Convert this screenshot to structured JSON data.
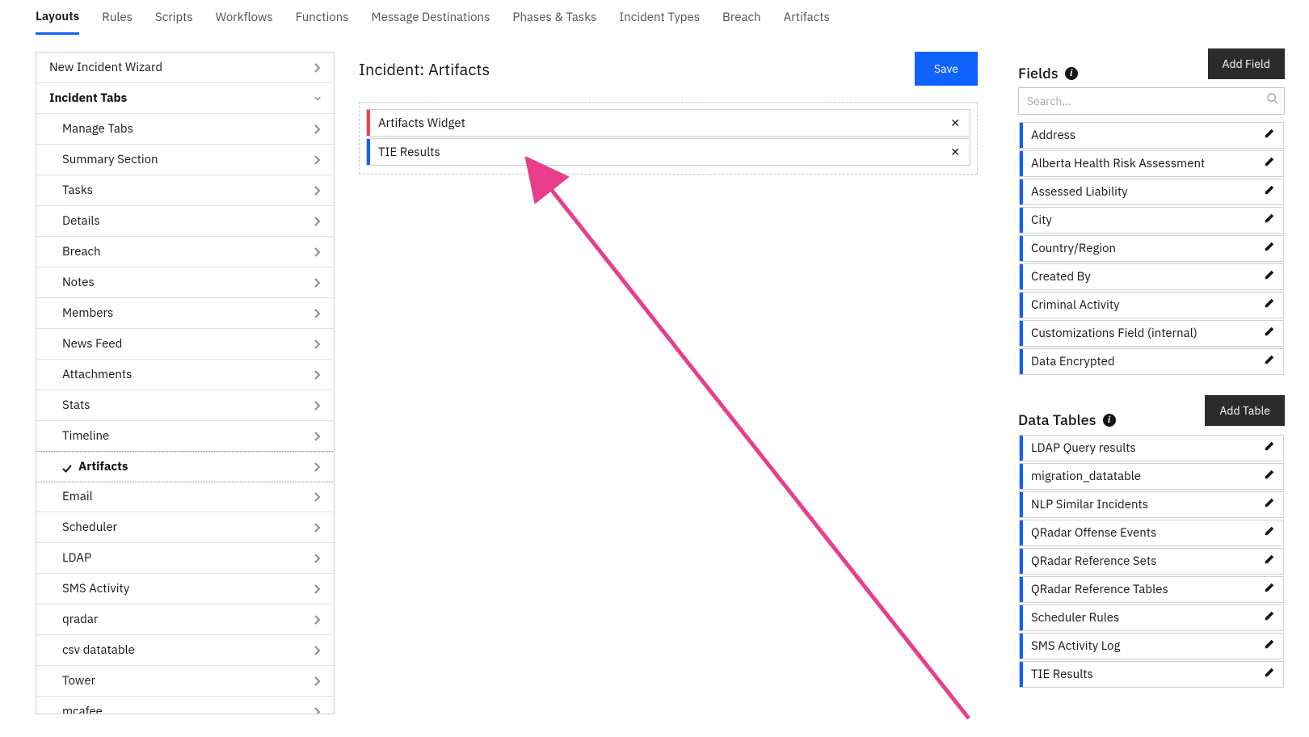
{
  "top_tabs": [
    {
      "label": "Layouts",
      "active": true
    },
    {
      "label": "Rules",
      "active": false
    },
    {
      "label": "Scripts",
      "active": false
    },
    {
      "label": "Workflows",
      "active": false
    },
    {
      "label": "Functions",
      "active": false
    },
    {
      "label": "Message Destinations",
      "active": false
    },
    {
      "label": "Phases & Tasks",
      "active": false
    },
    {
      "label": "Incident Types",
      "active": false
    },
    {
      "label": "Breach",
      "active": false
    },
    {
      "label": "Artifacts",
      "active": false
    }
  ],
  "sidebar": {
    "wizard_label": "New Incident Wizard",
    "section_label": "Incident Tabs",
    "items": [
      {
        "label": "Manage Tabs",
        "active": false
      },
      {
        "label": "Summary Section",
        "active": false
      },
      {
        "label": "Tasks",
        "active": false
      },
      {
        "label": "Details",
        "active": false
      },
      {
        "label": "Breach",
        "active": false
      },
      {
        "label": "Notes",
        "active": false
      },
      {
        "label": "Members",
        "active": false
      },
      {
        "label": "News Feed",
        "active": false
      },
      {
        "label": "Attachments",
        "active": false
      },
      {
        "label": "Stats",
        "active": false
      },
      {
        "label": "Timeline",
        "active": false
      },
      {
        "label": "Artifacts",
        "active": true
      },
      {
        "label": "Email",
        "active": false
      },
      {
        "label": "Scheduler",
        "active": false
      },
      {
        "label": "LDAP",
        "active": false
      },
      {
        "label": "SMS Activity",
        "active": false
      },
      {
        "label": "qradar",
        "active": false
      },
      {
        "label": "csv datatable",
        "active": false
      },
      {
        "label": "Tower",
        "active": false
      },
      {
        "label": "mcafee",
        "active": false
      }
    ]
  },
  "editor": {
    "heading": "Incident: Artifacts",
    "save_label": "Save",
    "widgets": [
      {
        "label": "Artifacts Widget",
        "color": "red"
      },
      {
        "label": "TIE Results",
        "color": "blue"
      }
    ]
  },
  "right": {
    "fields_label": "Fields",
    "add_field_label": "Add Field",
    "search_placeholder": "Search…",
    "fields": [
      {
        "label": "Address"
      },
      {
        "label": "Alberta Health Risk Assessment"
      },
      {
        "label": "Assessed Liability"
      },
      {
        "label": "City"
      },
      {
        "label": "Country/Region"
      },
      {
        "label": "Created By"
      },
      {
        "label": "Criminal Activity"
      },
      {
        "label": "Customizations Field (internal)"
      },
      {
        "label": "Data Encrypted"
      }
    ],
    "tables_label": "Data Tables",
    "add_table_label": "Add Table",
    "tables": [
      {
        "label": "LDAP Query results"
      },
      {
        "label": "migration_datatable"
      },
      {
        "label": "NLP Similar Incidents"
      },
      {
        "label": "QRadar Offense Events"
      },
      {
        "label": "QRadar Reference Sets"
      },
      {
        "label": "QRadar Reference Tables"
      },
      {
        "label": "Scheduler Rules"
      },
      {
        "label": "SMS Activity Log"
      },
      {
        "label": "TIE Results"
      }
    ]
  }
}
